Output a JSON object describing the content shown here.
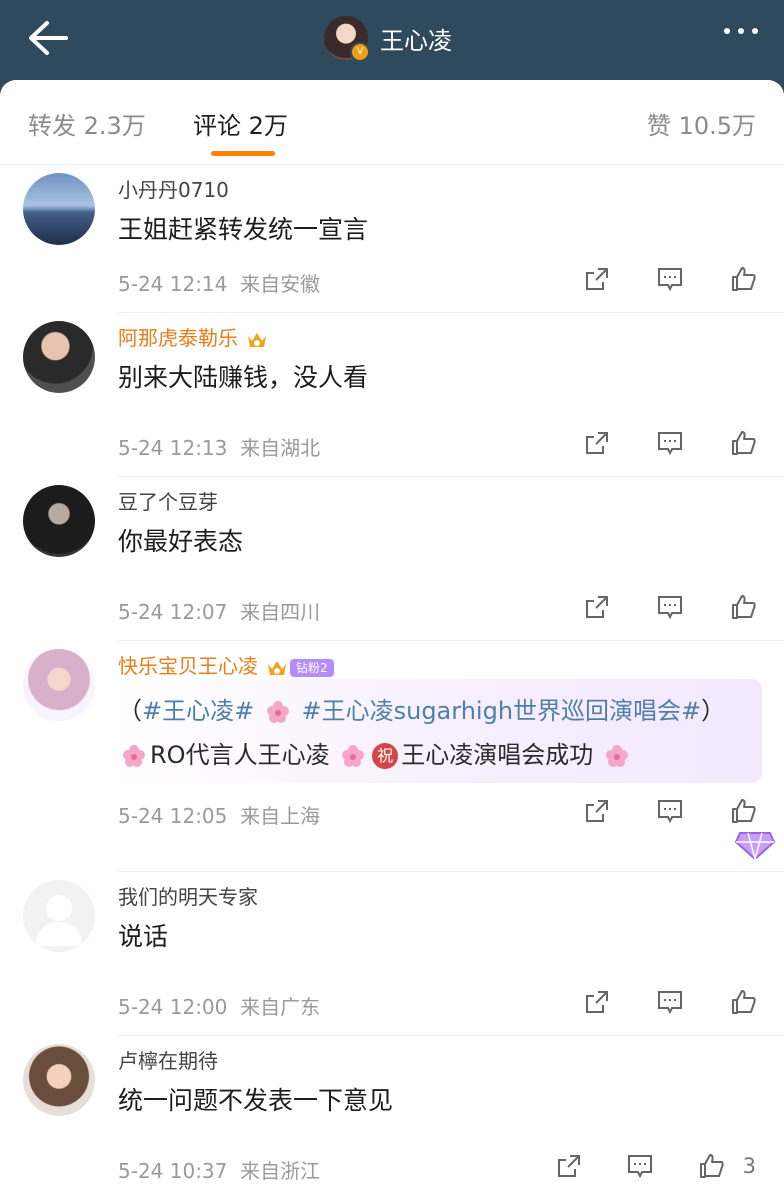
{
  "header": {
    "title": "王心凌",
    "verified_mark": "V"
  },
  "tabs": [
    {
      "label": "转发 2.3万"
    },
    {
      "label": "评论 2万"
    },
    {
      "label": "赞 10.5万"
    }
  ],
  "comments": [
    {
      "name": "小丹丹0710",
      "text": "王姐赶紧转发统一宣言",
      "time": "5-24 12:14",
      "location": "来自安徽"
    },
    {
      "name": "阿那虎泰勒乐",
      "text": "别来大陆赚钱，没人看",
      "time": "5-24 12:13",
      "location": "来自湖北"
    },
    {
      "name": "豆了个豆芽",
      "text": "你最好表态",
      "time": "5-24 12:07",
      "location": "来自四川"
    },
    {
      "name": "快乐宝贝王心凌",
      "fan_badge": "钻粉2",
      "rich_parts": [
        "（",
        "#王心凌#",
        "#王心凌sugarhigh世界巡回演唱会#",
        "）",
        "RO代言人王心凌",
        "祝",
        "王心凌演唱会成功"
      ],
      "time": "5-24 12:05",
      "location": "来自上海"
    },
    {
      "name": "我们的明天专家",
      "text": "说话",
      "time": "5-24 12:00",
      "location": "来自广东"
    },
    {
      "name": "卢檸在期待",
      "text": "统一问题不发表一下意见",
      "time": "5-24 10:37",
      "location": "来自浙江",
      "likes": "3"
    }
  ],
  "colors": {
    "header": "#2f4a5c",
    "accent": "#ff8200",
    "username_vip": "#ec7c17",
    "hashtag": "#4f7ead"
  },
  "icons": [
    "back-arrow-icon",
    "more-dots-icon",
    "repost-icon",
    "comment-icon",
    "like-icon",
    "crown-icon",
    "blossom-icon",
    "gem-icon"
  ]
}
